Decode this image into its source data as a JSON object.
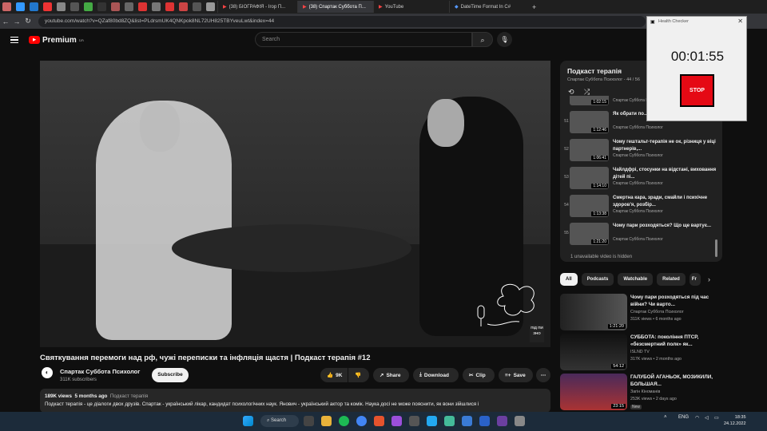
{
  "browser": {
    "tabs": [
      {
        "title": "(38) БІОГРАФІЯ - Ігор П..."
      },
      {
        "title": "(38) Спартак Суббота П..."
      },
      {
        "title": "YouTube"
      },
      {
        "title": "DateTime Format In C#"
      }
    ],
    "url": "youtube.com/watch?v=QZaf80bd8ZQ&list=PLdrsmUK4QNKpok8NL72UH825TBYveuLwt&index=44"
  },
  "header": {
    "logo_text": "Premium",
    "logo_region": "UA",
    "search_placeholder": "Search"
  },
  "video": {
    "watermark": "ПІД ПИ ЗНО",
    "title": "Святкування перемоги над рф, чужі переписки та інфляція щастя | Подкаст терапія #12",
    "channel": "Спартак Суббота Психолог",
    "subscribers": "311K subscribers",
    "subscribe_label": "Subscribe",
    "likes": "9K",
    "share_label": "Share",
    "download_label": "Download",
    "clip_label": "Clip",
    "save_label": "Save",
    "views": "189K views",
    "age": "5 months ago",
    "tag": "Подкаст терапія",
    "description": "Подкаст терапія - це діалоги двох друзів. Спартак - український лікар, кандидат психологічних наук. Янович - український актор та комік. Наука досі не може пояснити, як вони зійшлися і"
  },
  "playlist": {
    "title": "Подкаст терапія",
    "subtitle": "Спартак Суббота Психолог - 44 / 56",
    "partial_duration": "1:02:15",
    "partial_channel": "Спартак Суббота Психолог",
    "items": [
      {
        "num": "51",
        "duration": "1:12:46",
        "title": "Як обрати по... можна мститися людям? |...",
        "channel": "Спартак Суббота Психолог"
      },
      {
        "num": "52",
        "duration": "1:06:41",
        "title": "Чому гештальт-терапія не ок, різниця у віці партнерів,...",
        "channel": "Спартак Суббота Психолог"
      },
      {
        "num": "53",
        "duration": "1:14:10",
        "title": "Чайлдфрі, стосунки на відстані, виховання дітей пі...",
        "channel": "Спартак Суббота Психолог"
      },
      {
        "num": "54",
        "duration": "1:13:38",
        "title": "Смертна кара, зради, смайли і психічне здоров'я, розбір...",
        "channel": "Спартак Суббота Психолог"
      },
      {
        "num": "55",
        "duration": "1:21:20",
        "title": "Чому пари розходяться? Що ще вартує...",
        "channel": "Спартак Суббота Психолог"
      }
    ],
    "unavailable": "1 unavailable video is hidden"
  },
  "chips": [
    "All",
    "Podcasts",
    "Watchable",
    "Related",
    "Fr"
  ],
  "recommendations": [
    {
      "title": "Чому пари розходяться під час війни? Чи варто...",
      "channel": "Спартак Суббота Психолог",
      "views": "311K views • 6 months ago",
      "duration": "1:21:20",
      "badge": ""
    },
    {
      "title": "СУББОТА: покоління ПТСР, «безсмертний полк» як...",
      "channel": "ISLND TV",
      "views": "317K views • 2 months ago",
      "duration": "54:12",
      "badge": ""
    },
    {
      "title": "ГАЛУБОЙ АГАНЬОК, МОЗИКИЛИ, БОЛЬШАЯ...",
      "channel": "Загін Кіноманів",
      "views": "253K views • 2 days ago",
      "duration": "23:15",
      "badge": "New"
    }
  ],
  "health_checker": {
    "title": "Health Checker",
    "timer": "00:01:55",
    "stop_label": "STOP"
  },
  "taskbar": {
    "search_label": "Search",
    "lang": "ENG",
    "time": "18:35",
    "date": "24.12.2022"
  }
}
